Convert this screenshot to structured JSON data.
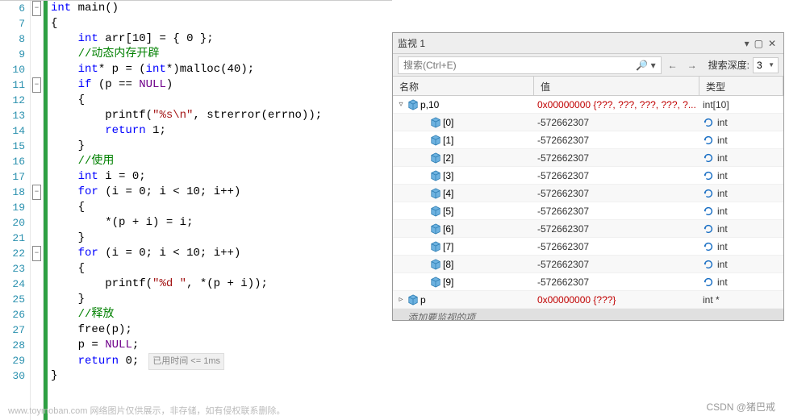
{
  "editor": {
    "line_start": 6,
    "line_end": 30,
    "fold_lines": [
      6,
      11,
      18,
      22
    ],
    "timing_label": "已用时间 <= 1ms",
    "lines": [
      {
        "n": 6,
        "tokens": [
          [
            "kw",
            "int"
          ],
          [
            "id",
            " main"
          ],
          [
            "op",
            "()"
          ]
        ]
      },
      {
        "n": 7,
        "tokens": [
          [
            "op",
            "{"
          ]
        ]
      },
      {
        "n": 8,
        "tokens": [
          [
            "op",
            "    "
          ],
          [
            "kw",
            "int"
          ],
          [
            "id",
            " arr"
          ],
          [
            "op",
            "["
          ],
          [
            "num",
            "10"
          ],
          [
            "op",
            "] = { "
          ],
          [
            "num",
            "0"
          ],
          [
            "op",
            " };"
          ]
        ]
      },
      {
        "n": 9,
        "tokens": [
          [
            "op",
            "    "
          ],
          [
            "cmt",
            "//动态内存开辟"
          ]
        ]
      },
      {
        "n": 10,
        "tokens": [
          [
            "op",
            "    "
          ],
          [
            "kw",
            "int"
          ],
          [
            "op",
            "* "
          ],
          [
            "id",
            "p"
          ],
          [
            "op",
            " = ("
          ],
          [
            "kw",
            "int"
          ],
          [
            "op",
            "*)"
          ],
          [
            "id",
            "malloc"
          ],
          [
            "op",
            "("
          ],
          [
            "num",
            "40"
          ],
          [
            "op",
            ");"
          ]
        ]
      },
      {
        "n": 11,
        "tokens": [
          [
            "op",
            "    "
          ],
          [
            "kw",
            "if"
          ],
          [
            "op",
            " ("
          ],
          [
            "id",
            "p"
          ],
          [
            "op",
            " == "
          ],
          [
            "macro",
            "NULL"
          ],
          [
            "op",
            ")"
          ]
        ]
      },
      {
        "n": 12,
        "tokens": [
          [
            "op",
            "    {"
          ]
        ]
      },
      {
        "n": 13,
        "tokens": [
          [
            "op",
            "        "
          ],
          [
            "id",
            "printf"
          ],
          [
            "op",
            "("
          ],
          [
            "str",
            "\"%s\\n\""
          ],
          [
            "op",
            ", "
          ],
          [
            "id",
            "strerror"
          ],
          [
            "op",
            "("
          ],
          [
            "id",
            "errno"
          ],
          [
            "op",
            "));"
          ]
        ]
      },
      {
        "n": 14,
        "tokens": [
          [
            "op",
            "        "
          ],
          [
            "kw",
            "return"
          ],
          [
            "op",
            " "
          ],
          [
            "num",
            "1"
          ],
          [
            "op",
            ";"
          ]
        ]
      },
      {
        "n": 15,
        "tokens": [
          [
            "op",
            "    }"
          ]
        ]
      },
      {
        "n": 16,
        "tokens": [
          [
            "op",
            "    "
          ],
          [
            "cmt",
            "//使用"
          ]
        ]
      },
      {
        "n": 17,
        "tokens": [
          [
            "op",
            "    "
          ],
          [
            "kw",
            "int"
          ],
          [
            "id",
            " i"
          ],
          [
            "op",
            " = "
          ],
          [
            "num",
            "0"
          ],
          [
            "op",
            ";"
          ]
        ]
      },
      {
        "n": 18,
        "tokens": [
          [
            "op",
            "    "
          ],
          [
            "kw",
            "for"
          ],
          [
            "op",
            " ("
          ],
          [
            "id",
            "i"
          ],
          [
            "op",
            " = "
          ],
          [
            "num",
            "0"
          ],
          [
            "op",
            "; "
          ],
          [
            "id",
            "i"
          ],
          [
            "op",
            " < "
          ],
          [
            "num",
            "10"
          ],
          [
            "op",
            "; "
          ],
          [
            "id",
            "i"
          ],
          [
            "op",
            "++)"
          ]
        ]
      },
      {
        "n": 19,
        "tokens": [
          [
            "op",
            "    {"
          ]
        ]
      },
      {
        "n": 20,
        "tokens": [
          [
            "op",
            "        *("
          ],
          [
            "id",
            "p"
          ],
          [
            "op",
            " + "
          ],
          [
            "id",
            "i"
          ],
          [
            "op",
            ") = "
          ],
          [
            "id",
            "i"
          ],
          [
            "op",
            ";"
          ]
        ]
      },
      {
        "n": 21,
        "tokens": [
          [
            "op",
            "    }"
          ]
        ]
      },
      {
        "n": 22,
        "tokens": [
          [
            "op",
            "    "
          ],
          [
            "kw",
            "for"
          ],
          [
            "op",
            " ("
          ],
          [
            "id",
            "i"
          ],
          [
            "op",
            " = "
          ],
          [
            "num",
            "0"
          ],
          [
            "op",
            "; "
          ],
          [
            "id",
            "i"
          ],
          [
            "op",
            " < "
          ],
          [
            "num",
            "10"
          ],
          [
            "op",
            "; "
          ],
          [
            "id",
            "i"
          ],
          [
            "op",
            "++)"
          ]
        ]
      },
      {
        "n": 23,
        "tokens": [
          [
            "op",
            "    {"
          ]
        ]
      },
      {
        "n": 24,
        "tokens": [
          [
            "op",
            "        "
          ],
          [
            "id",
            "printf"
          ],
          [
            "op",
            "("
          ],
          [
            "str",
            "\"%d \""
          ],
          [
            "op",
            ", *("
          ],
          [
            "id",
            "p"
          ],
          [
            "op",
            " + "
          ],
          [
            "id",
            "i"
          ],
          [
            "op",
            "));"
          ]
        ]
      },
      {
        "n": 25,
        "tokens": [
          [
            "op",
            "    }"
          ]
        ]
      },
      {
        "n": 26,
        "tokens": [
          [
            "op",
            "    "
          ],
          [
            "cmt",
            "//释放"
          ]
        ]
      },
      {
        "n": 27,
        "tokens": [
          [
            "op",
            "    "
          ],
          [
            "id",
            "free"
          ],
          [
            "op",
            "("
          ],
          [
            "id",
            "p"
          ],
          [
            "op",
            ");"
          ]
        ]
      },
      {
        "n": 28,
        "tokens": [
          [
            "op",
            "    "
          ],
          [
            "id",
            "p"
          ],
          [
            "op",
            " = "
          ],
          [
            "macro",
            "NULL"
          ],
          [
            "op",
            ";"
          ]
        ]
      },
      {
        "n": 29,
        "tokens": [
          [
            "op",
            "    "
          ],
          [
            "kw",
            "return"
          ],
          [
            "op",
            " "
          ],
          [
            "num",
            "0"
          ],
          [
            "op",
            ";"
          ]
        ],
        "timing": true
      },
      {
        "n": 30,
        "tokens": [
          [
            "op",
            "}"
          ]
        ]
      }
    ]
  },
  "watch": {
    "title": "监视 1",
    "search_placeholder": "搜索(Ctrl+E)",
    "depth_label": "搜索深度:",
    "depth_value": "3",
    "headers": {
      "name": "名称",
      "value": "值",
      "type": "类型"
    },
    "placeholder_text": "添加要监视的项",
    "rows": [
      {
        "indent": 0,
        "expander": "▿",
        "name": "p,10",
        "value": "0x00000000 {???, ???, ???, ???, ?...",
        "type": "int[10]",
        "red": true,
        "refresh": false
      },
      {
        "indent": 1,
        "expander": "",
        "name": "[0]",
        "value": "-572662307",
        "type": "int",
        "red": false,
        "refresh": true
      },
      {
        "indent": 1,
        "expander": "",
        "name": "[1]",
        "value": "-572662307",
        "type": "int",
        "red": false,
        "refresh": true
      },
      {
        "indent": 1,
        "expander": "",
        "name": "[2]",
        "value": "-572662307",
        "type": "int",
        "red": false,
        "refresh": true
      },
      {
        "indent": 1,
        "expander": "",
        "name": "[3]",
        "value": "-572662307",
        "type": "int",
        "red": false,
        "refresh": true
      },
      {
        "indent": 1,
        "expander": "",
        "name": "[4]",
        "value": "-572662307",
        "type": "int",
        "red": false,
        "refresh": true
      },
      {
        "indent": 1,
        "expander": "",
        "name": "[5]",
        "value": "-572662307",
        "type": "int",
        "red": false,
        "refresh": true
      },
      {
        "indent": 1,
        "expander": "",
        "name": "[6]",
        "value": "-572662307",
        "type": "int",
        "red": false,
        "refresh": true
      },
      {
        "indent": 1,
        "expander": "",
        "name": "[7]",
        "value": "-572662307",
        "type": "int",
        "red": false,
        "refresh": true
      },
      {
        "indent": 1,
        "expander": "",
        "name": "[8]",
        "value": "-572662307",
        "type": "int",
        "red": false,
        "refresh": true
      },
      {
        "indent": 1,
        "expander": "",
        "name": "[9]",
        "value": "-572662307",
        "type": "int",
        "red": false,
        "refresh": true
      },
      {
        "indent": 0,
        "expander": "▹",
        "name": "p",
        "value": "0x00000000 {???}",
        "type": "int *",
        "red": true,
        "refresh": false
      }
    ]
  },
  "footer": {
    "watermark_left": "www.toymoban.com  网络图片仅供展示，非存储，如有侵权联系删除。",
    "credit_right": "CSDN @猪巴戒"
  }
}
